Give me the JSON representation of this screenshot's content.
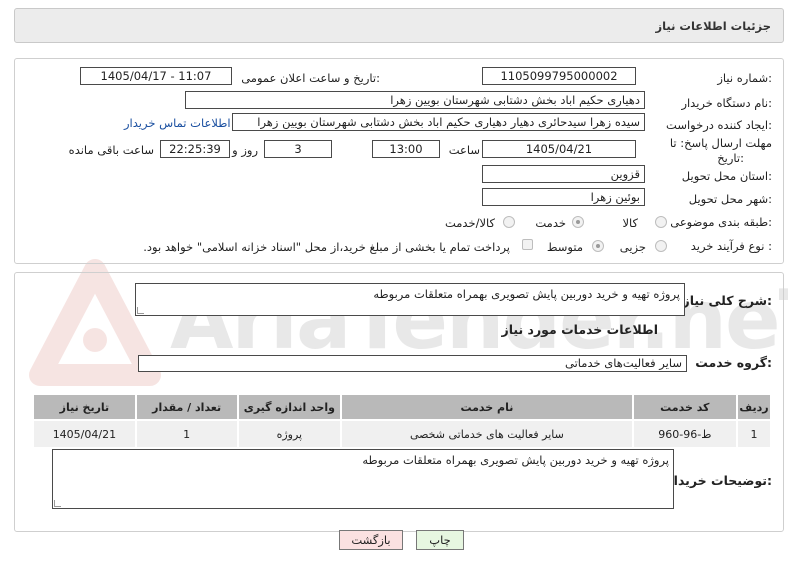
{
  "header": {
    "title": "جزئیات اطلاعات نیاز"
  },
  "form": {
    "need_number_label": "شماره نیاز:",
    "need_number": "1105099795000002",
    "announce_datetime_label": "تاریخ و ساعت اعلان عمومی:",
    "announce_datetime": "1405/04/17 - 11:07",
    "buyer_org_label": "نام دستگاه خریدار:",
    "buyer_org": "دهیاری حکیم اباد بخش دشتابی شهرستان بویین زهرا",
    "requester_label": "ایجاد کننده درخواست:",
    "requester": "سیده زهرا سیدحائری دهیار دهیاری حکیم اباد بخش دشتابی شهرستان بویین زهرا",
    "buyer_contact_link": "اطلاعات تماس خریدار",
    "deadline_label_1": "مهلت ارسال پاسخ: تا",
    "deadline_label_2": "تاریخ:",
    "deadline_date": "1405/04/21",
    "time_label": "ساعت",
    "deadline_time": "13:00",
    "days_value": "3",
    "days_label": "روز و",
    "remaining_time": "22:25:39",
    "remaining_label": "ساعت باقی مانده",
    "province_label": "استان محل تحویل:",
    "province": "قزوین",
    "city_label": "شهر محل تحویل:",
    "city": "بوئین زهرا",
    "category_label": "طبقه بندی موضوعی:",
    "category_options": [
      "کالا",
      "خدمت",
      "کالا/خدمت"
    ],
    "category_selected": "خدمت",
    "process_label": "نوع فرآیند خرید :",
    "process_options": [
      "جزیی",
      "متوسط"
    ],
    "process_selected": "متوسط",
    "payment_note": "پرداخت تمام یا بخشی از مبلغ خرید،از محل \"اسناد خزانه اسلامی\" خواهد بود."
  },
  "summary": {
    "label": "شرح کلی نیاز:",
    "text": "پروژه تهیه و خرید دوربین پایش تصویری  بهمراه متعلقات مربوطه"
  },
  "services": {
    "section_title": "اطلاعات خدمات مورد نیاز",
    "group_label": "گروه خدمت:",
    "group_value": "سایر فعالیت‌های خدماتی",
    "table": {
      "headers": [
        "ردیف",
        "کد خدمت",
        "نام خدمت",
        "واحد اندازه گیری",
        "تعداد / مقدار",
        "تاریخ نیاز"
      ],
      "rows": [
        [
          "1",
          "ط-96-960",
          "سایر فعالیت های خدماتی شخصی",
          "پروژه",
          "1",
          "1405/04/21"
        ]
      ]
    }
  },
  "buyer_notes": {
    "label": "توضیحات خریدار:",
    "text": "پروژه تهیه و خرید دوربین پایش تصویری  بهمراه متعلقات مربوطه"
  },
  "buttons": {
    "print": "چاپ",
    "back": "بازگشت"
  },
  "watermark": {
    "text": "AriaTender.neT"
  },
  "colors": {
    "link": "#1a4fa0",
    "back_button_bg": "#fbe1e1",
    "print_button_bg": "#e6f6e0",
    "header_bg": "#ececec",
    "table_header_bg": "#b9b9b9"
  }
}
